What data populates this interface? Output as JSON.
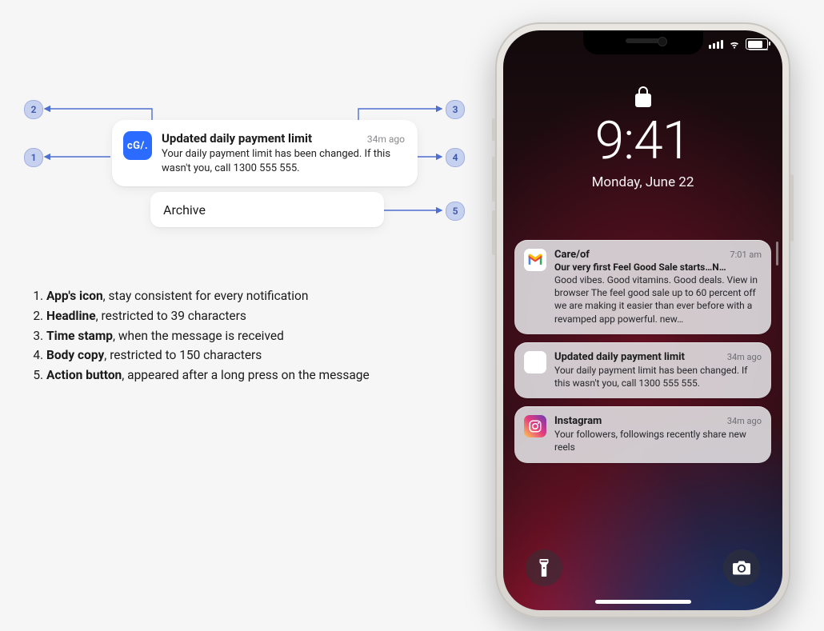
{
  "sample_notification": {
    "icon_label": "cG/.",
    "title": "Updated daily payment limit",
    "ago": "34m ago",
    "body": "Your daily payment limit has been changed. If this wasn't you, call 1300 555 555.",
    "action_label": "Archive"
  },
  "annotations": {
    "badges": {
      "b1": "1",
      "b2": "2",
      "b3": "3",
      "b4": "4",
      "b5": "5"
    }
  },
  "legend": [
    {
      "n": "1.",
      "term": "App's icon",
      "rest": ", stay consistent for every notification"
    },
    {
      "n": "2.",
      "term": "Headline",
      "rest": ", restricted to 39 characters"
    },
    {
      "n": "3.",
      "term": "Time stamp",
      "rest": ", when the message is received"
    },
    {
      "n": "4.",
      "term": "Body copy",
      "rest": ", restricted to 150 characters"
    },
    {
      "n": "5.",
      "term": "Action button",
      "rest": ", appeared after a long press on the message"
    }
  ],
  "lockscreen": {
    "time": "9:41",
    "date": "Monday, June 22"
  },
  "phone_notifications": [
    {
      "app": "Care/of",
      "ago": "7:01 am",
      "subtitle": "Our very first Feel Good Sale starts…N…",
      "body": "Good vibes. Good vitamins. Good deals. View in browser The feel good sale up to 60 percent off we are making it easier than ever before with a revamped app powerful. new…",
      "icon": "gmail"
    },
    {
      "app": "Updated daily payment limit",
      "ago": "34m ago",
      "subtitle": "",
      "body": "Your daily payment limit has been changed. If this wasn't you, call 1300 555 555.",
      "icon": "cgof"
    },
    {
      "app": "Instagram",
      "ago": "34m ago",
      "subtitle": "",
      "body": "Your followers, followings recently share new reels",
      "icon": "instagram"
    }
  ]
}
